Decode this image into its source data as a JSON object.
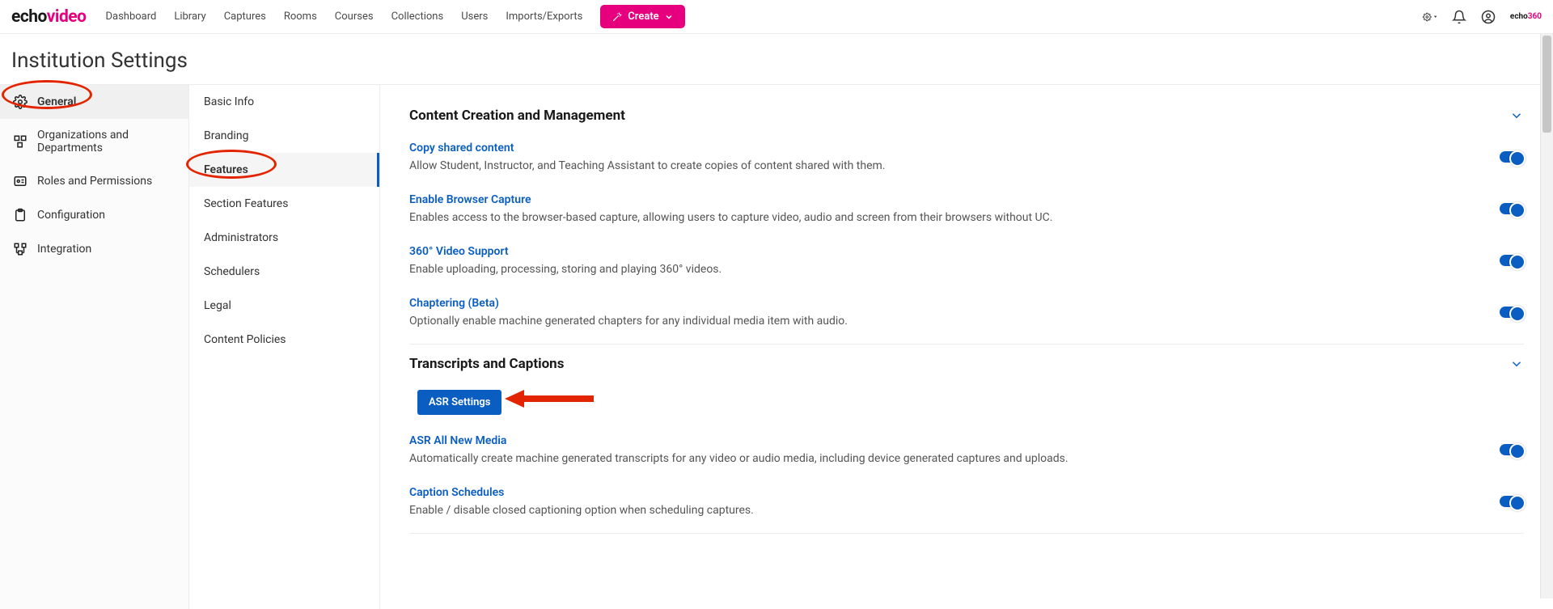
{
  "brand": {
    "part1": "echo",
    "part2": "video"
  },
  "topnav": {
    "items": [
      "Dashboard",
      "Library",
      "Captures",
      "Rooms",
      "Courses",
      "Collections",
      "Users",
      "Imports/Exports"
    ],
    "create_label": "Create"
  },
  "mini_brand": {
    "part1": "echo",
    "part2": "360"
  },
  "page_title": "Institution Settings",
  "leftnav": {
    "items": [
      {
        "label": "General",
        "active": true
      },
      {
        "label": "Organizations and Departments",
        "active": false
      },
      {
        "label": "Roles and Permissions",
        "active": false
      },
      {
        "label": "Configuration",
        "active": false
      },
      {
        "label": "Integration",
        "active": false
      }
    ]
  },
  "subnav": {
    "items": [
      {
        "label": "Basic Info",
        "active": false
      },
      {
        "label": "Branding",
        "active": false
      },
      {
        "label": "Features",
        "active": true
      },
      {
        "label": "Section Features",
        "active": false
      },
      {
        "label": "Administrators",
        "active": false
      },
      {
        "label": "Schedulers",
        "active": false
      },
      {
        "label": "Legal",
        "active": false
      },
      {
        "label": "Content Policies",
        "active": false
      }
    ]
  },
  "main": {
    "sections": [
      {
        "title": "Content Creation and Management",
        "features": [
          {
            "title": "Copy shared content",
            "desc": "Allow Student, Instructor, and Teaching Assistant to create copies of content shared with them.",
            "on": true
          },
          {
            "title": "Enable Browser Capture",
            "desc": "Enables access to the browser-based capture, allowing users to capture video, audio and screen from their browsers without UC.",
            "on": true
          },
          {
            "title": "360° Video Support",
            "desc": "Enable uploading, processing, storing and playing 360° videos.",
            "on": true
          },
          {
            "title": "Chaptering (Beta)",
            "desc": "Optionally enable machine generated chapters for any individual media item with audio.",
            "on": true
          }
        ]
      },
      {
        "title": "Transcripts and Captions",
        "asr_button": "ASR Settings",
        "features": [
          {
            "title": "ASR All New Media",
            "desc": "Automatically create machine generated transcripts for any video or audio media, including device generated captures and uploads.",
            "on": true
          },
          {
            "title": "Caption Schedules",
            "desc": "Enable / disable closed captioning option when scheduling captures.",
            "on": true
          }
        ]
      }
    ]
  }
}
